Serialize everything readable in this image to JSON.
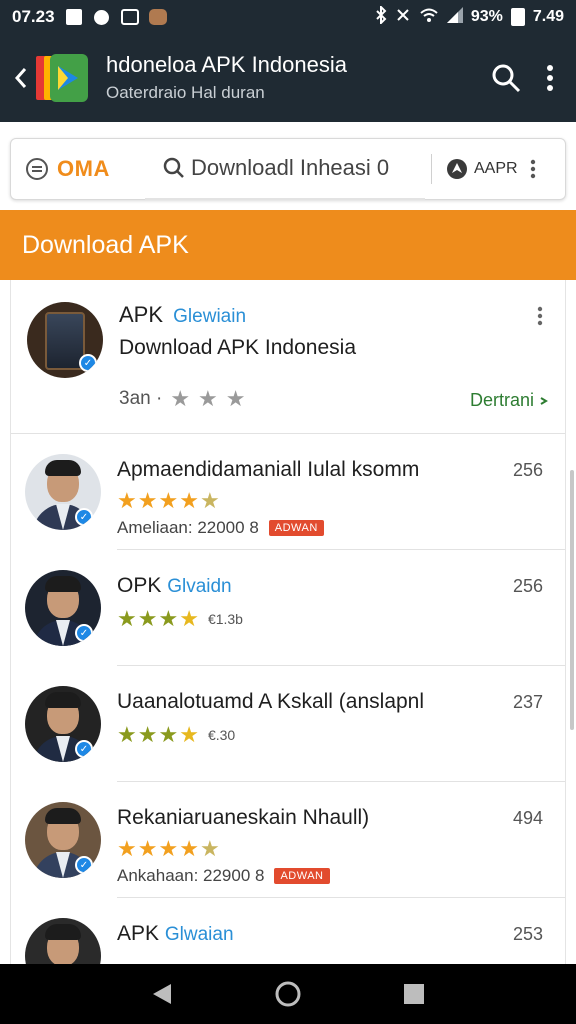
{
  "status_bar": {
    "time": "07.23",
    "battery": "93%",
    "clock": "7.49"
  },
  "app_bar": {
    "title": "hdoneloa APK Indonesia",
    "subtitle": "Oaterdraio Hal duran"
  },
  "search": {
    "brand": "OMA",
    "query": "Downloadl Inheasi 0",
    "right_label": "AAPR"
  },
  "section": {
    "title": "Download APK"
  },
  "featured": {
    "title": "APK",
    "tag": "Glewiain",
    "subtitle": "Download APK Indonesia",
    "meta": "3an ·",
    "action": "Dertrani"
  },
  "items": [
    {
      "title": "Apmaendidamaniall Iulal ksomm",
      "num": "256",
      "rating": 4.5,
      "meta": "Ameliaan: 22000 8",
      "badge": "ADWAN"
    },
    {
      "title": "OPK",
      "tag": "Glvaidn",
      "num": "256",
      "rating": 4,
      "small": "€1.3b"
    },
    {
      "title": "Uaanalotuamd A Kskall (anslapnl",
      "num": "237",
      "rating": 4,
      "small": "€.30"
    },
    {
      "title": "Rekaniaruaneskain Nhaull)",
      "num": "494",
      "rating": 4.5,
      "meta": "Ankahaan: 22900 8",
      "badge": "ADWAN"
    },
    {
      "title": "APK",
      "tag": "Glwaian",
      "num": "253"
    }
  ],
  "colors": {
    "app_bar": "#1f2a33",
    "accent_orange": "#ee8c1c",
    "link_blue": "#2a8fd6",
    "action_green": "#2e7d32",
    "badge_red": "#e24b2e"
  }
}
